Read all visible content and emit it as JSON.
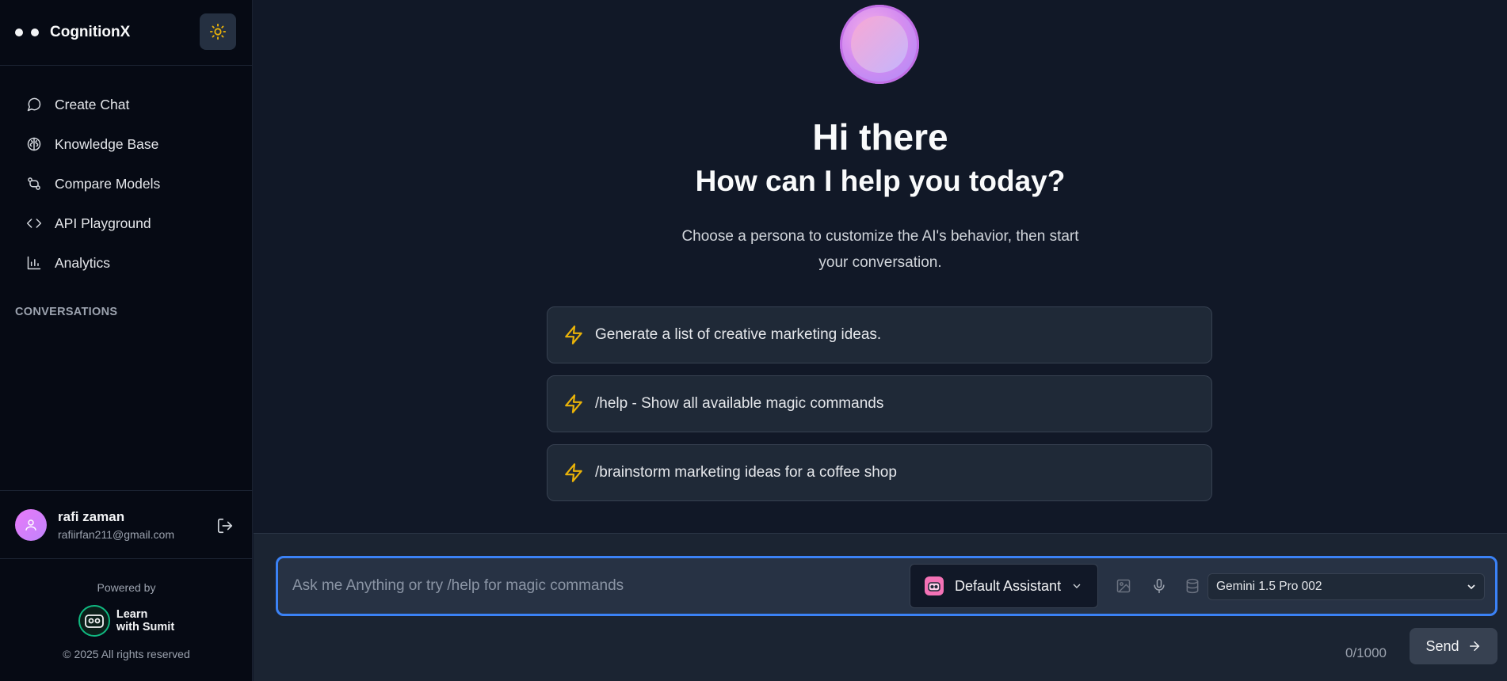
{
  "brand": {
    "name": "CognitionX"
  },
  "colors": {
    "accent": "#3b82f6",
    "sidebar": "#060a14",
    "main": "#111827",
    "lightning": "#eab308"
  },
  "nav": {
    "items": [
      {
        "label": "Create Chat",
        "icon": "chat-bubble-icon"
      },
      {
        "label": "Knowledge Base",
        "icon": "brain-icon"
      },
      {
        "label": "Compare Models",
        "icon": "git-compare-icon"
      },
      {
        "label": "API Playground",
        "icon": "code-icon"
      },
      {
        "label": "Analytics",
        "icon": "bar-chart-icon"
      }
    ],
    "section_label": "CONVERSATIONS"
  },
  "user": {
    "name": "rafi zaman",
    "email": "rafiirfan211@gmail.com"
  },
  "footer": {
    "powered_by": "Powered by",
    "logo_line1": "Learn",
    "logo_line2": "with Sumit",
    "copyright": "© 2025 All rights reserved"
  },
  "hero": {
    "title": "Hi there",
    "subtitle": "How can I help you today?",
    "description": "Choose a persona to customize the AI's behavior, then start your conversation."
  },
  "suggestions": [
    "Generate a list of creative marketing ideas.",
    "/help - Show all available magic commands",
    "/brainstorm marketing ideas for a coffee shop"
  ],
  "composer": {
    "placeholder": "Ask me Anything or try /help for magic commands",
    "assistant": "Default Assistant",
    "model": "Gemini 1.5 Pro 002",
    "counter": "0/1000",
    "send_label": "Send"
  }
}
